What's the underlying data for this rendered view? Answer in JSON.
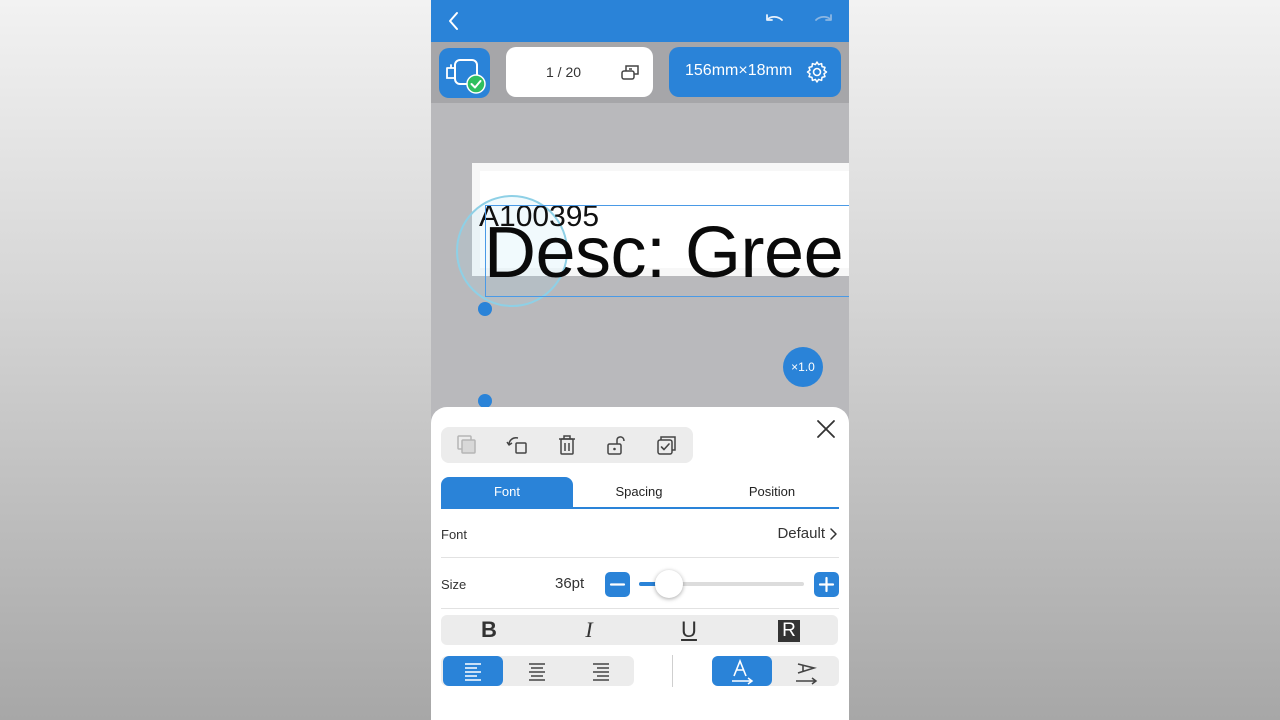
{
  "toolbar": {
    "page_counter": "1 / 20",
    "label_size": "156mm×18mm"
  },
  "canvas": {
    "text_line1": "A100395",
    "text_line2": "Desc: Gree",
    "scale_badge": "×1.0"
  },
  "sheet": {
    "tabs": [
      {
        "label": "Font",
        "active": true
      },
      {
        "label": "Spacing",
        "active": false
      },
      {
        "label": "Position",
        "active": false
      }
    ],
    "font_row": {
      "label": "Font",
      "value": "Default"
    },
    "size_row": {
      "label": "Size",
      "value": "36pt",
      "slider_fraction": 0.18
    },
    "style_buttons": [
      "B",
      "I",
      "U",
      "R"
    ],
    "alignment": {
      "selected": "left"
    },
    "direction": {
      "selected": "horizontal"
    }
  },
  "colors": {
    "accent": "#2a83d8",
    "canvas_bg": "#b9b9bc",
    "selection_ring": "#8ed0e6"
  }
}
